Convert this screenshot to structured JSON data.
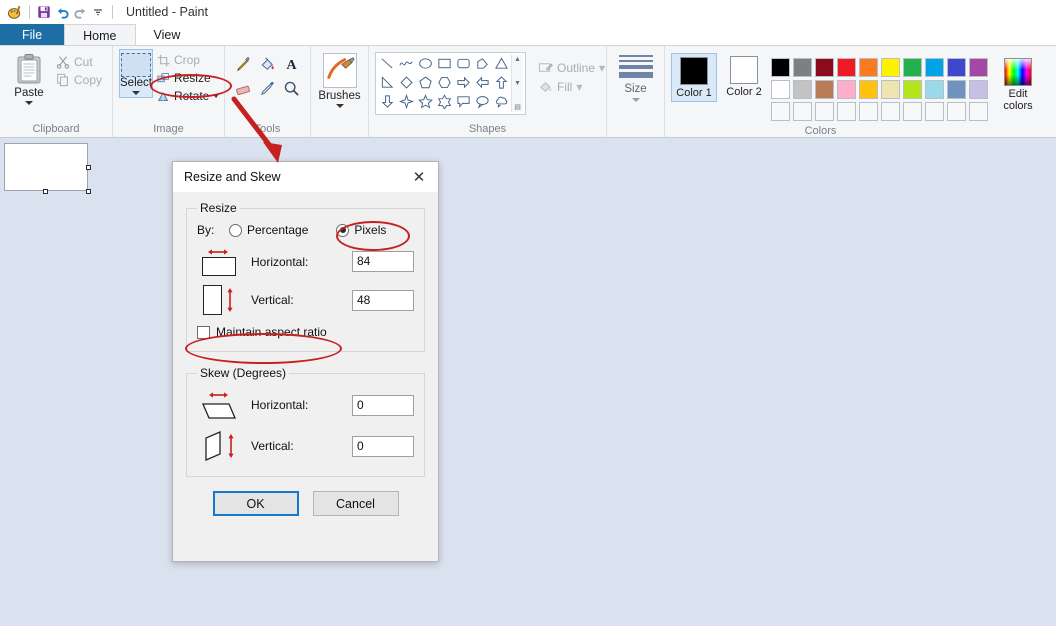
{
  "window": {
    "title": "Untitled - Paint",
    "quick_access": [
      {
        "name": "paint-icon",
        "glyph": "🎨"
      },
      {
        "name": "save-icon",
        "glyph": "💾"
      },
      {
        "name": "undo-icon",
        "glyph": "↩"
      },
      {
        "name": "redo-icon",
        "glyph": "↪"
      },
      {
        "name": "customize-qat-icon",
        "glyph": "▾"
      }
    ]
  },
  "tabs": [
    {
      "label": "File",
      "state": "file"
    },
    {
      "label": "Home",
      "state": "active"
    },
    {
      "label": "View",
      "state": "normal"
    }
  ],
  "ribbon": {
    "clipboard": {
      "label": "Clipboard",
      "paste": "Paste",
      "cut": "Cut",
      "copy": "Copy"
    },
    "image": {
      "label": "Image",
      "select": "Select",
      "crop": "Crop",
      "resize": "Resize",
      "rotate": "Rotate"
    },
    "tools": {
      "label": "Tools",
      "items": [
        "pencil-icon",
        "fill-icon",
        "text-icon",
        "eraser-icon",
        "color-picker-icon",
        "magnifier-icon"
      ]
    },
    "brushes": {
      "label": "Brushes"
    },
    "shapes": {
      "label": "Shapes",
      "outline": "Outline",
      "fill": "Fill",
      "items": [
        "line",
        "curve",
        "oval",
        "rectangle",
        "rounded-rectangle",
        "polygon",
        "triangle",
        "right-triangle",
        "diamond",
        "pentagon",
        "hexagon",
        "right-arrow",
        "left-arrow",
        "up-arrow",
        "down-arrow",
        "four-point-star",
        "five-point-star",
        "six-point-star",
        "rounded-callout",
        "oval-callout",
        "cloud-callout"
      ]
    },
    "size": {
      "label": "Size"
    },
    "colors": {
      "label": "Colors",
      "color1_label": "Color 1",
      "color2_label": "Color 2",
      "color1_value": "#000000",
      "color2_value": "#ffffff",
      "edit_colors": "Edit colors",
      "palette_row1": [
        "#000000",
        "#7f7f7f",
        "#8b0a1e",
        "#ed1c24",
        "#f87b20",
        "#fff200",
        "#22b14c",
        "#00a2e8",
        "#3f48cc",
        "#a349a4"
      ],
      "palette_row2": [
        "#ffffff",
        "#c3c3c3",
        "#b97a57",
        "#ffaec9",
        "#ffc20e",
        "#efe4b0",
        "#b5e61d",
        "#99d9ea",
        "#7092be",
        "#c8bfe7"
      ],
      "palette_row3": [
        "",
        "",
        "",
        "",
        "",
        "",
        "",
        "",
        "",
        ""
      ]
    }
  },
  "dialog": {
    "title": "Resize and Skew",
    "close_glyph": "✕",
    "resize": {
      "legend": "Resize",
      "by_label": "By:",
      "percentage_label": "Percentage",
      "pixels_label": "Pixels",
      "selected": "Pixels",
      "horizontal_label": "Horizontal:",
      "horizontal_value": "84",
      "vertical_label": "Vertical:",
      "vertical_value": "48",
      "maintain_aspect_label": "Maintain aspect ratio",
      "maintain_aspect_checked": false
    },
    "skew": {
      "legend": "Skew (Degrees)",
      "horizontal_label": "Horizontal:",
      "horizontal_value": "0",
      "vertical_label": "Vertical:",
      "vertical_value": "0"
    },
    "ok_label": "OK",
    "cancel_label": "Cancel"
  },
  "annotations": {
    "color": "#c62020",
    "items": [
      {
        "name": "resize-highlight-ellipse",
        "target": "Resize"
      },
      {
        "name": "pixels-highlight-ellipse",
        "target": "Pixels"
      },
      {
        "name": "maintain-aspect-highlight-ellipse",
        "target": "Maintain aspect ratio"
      },
      {
        "name": "resize-to-dialog-arrow",
        "target": "Resize and Skew"
      }
    ]
  }
}
